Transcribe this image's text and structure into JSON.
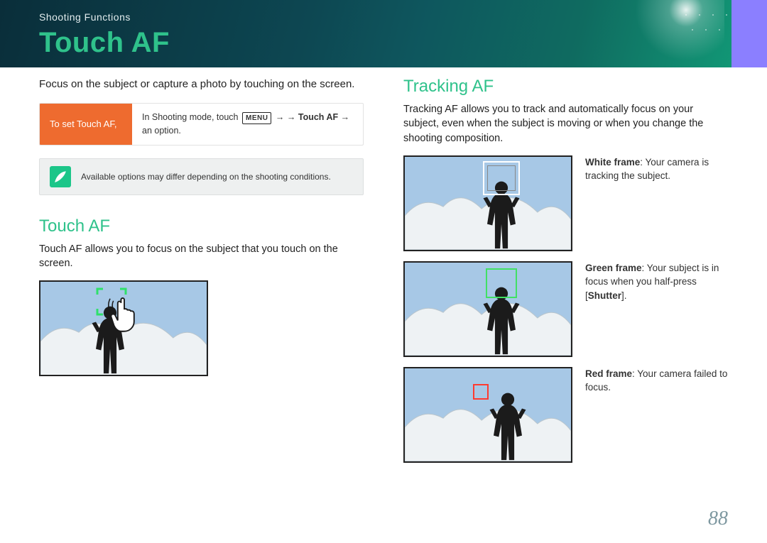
{
  "header": {
    "section_label": "Shooting Functions",
    "page_title": "Touch AF"
  },
  "left": {
    "intro": "Focus on the subject or capture a photo by touching on the screen.",
    "instr_label": "To set Touch AF,",
    "instr_prefix": "In Shooting mode, touch ",
    "instr_menu": "MENU",
    "instr_mid": " →     → ",
    "instr_bold": "Touch AF",
    "instr_mid2": " → ",
    "instr_suffix": "an option.",
    "note": "Available options may differ depending on the shooting conditions.",
    "h2": "Touch AF",
    "body": "Touch AF allows you to focus on the subject that you touch on the screen."
  },
  "right": {
    "h2": "Tracking AF",
    "body": "Tracking AF allows you to track and automatically focus on your subject, even when the subject is moving or when you change the shooting composition.",
    "white_bold": "White frame",
    "white_rest": ": Your camera is tracking the subject.",
    "green_bold": "Green frame",
    "green_rest1": ": Your subject is in focus when you half-press [",
    "green_shutter": "Shutter",
    "green_rest2": "].",
    "red_bold": "Red frame",
    "red_rest": ": Your camera failed to focus."
  },
  "page_number": "88"
}
